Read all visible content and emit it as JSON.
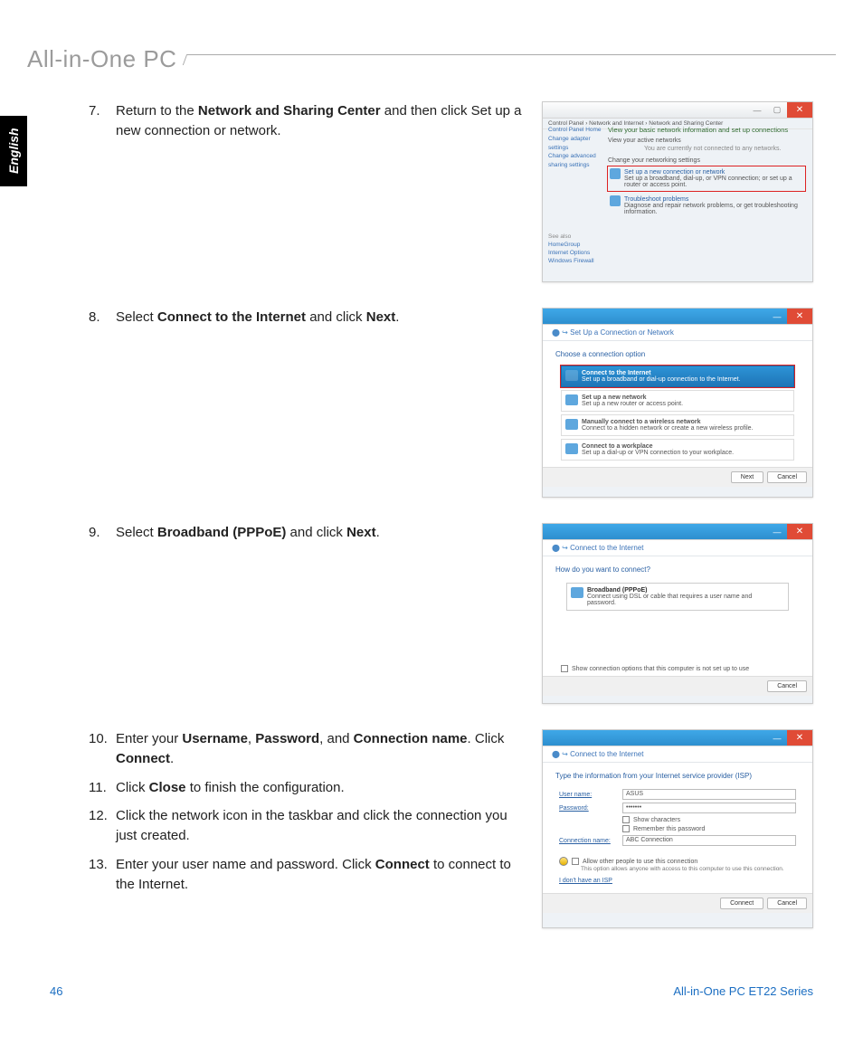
{
  "header": {
    "title": "All-in-One PC"
  },
  "lang_tab": "English",
  "footer": {
    "page": "46",
    "series": "All-in-One PC ET22 Series"
  },
  "sections": [
    {
      "steps": [
        {
          "num": "7.",
          "html": "Return to the <b>Network and Sharing Center</b> and then click Set up a new connection or network."
        }
      ],
      "shot": "nsc"
    },
    {
      "steps": [
        {
          "num": "8.",
          "html": "Select <b>Connect to the Internet</b> and click <b>Next</b>."
        }
      ],
      "shot": "options"
    },
    {
      "steps": [
        {
          "num": "9.",
          "html": "Select <b>Broadband (PPPoE)</b> and click <b>Next</b>."
        }
      ],
      "shot": "pppoe"
    },
    {
      "steps": [
        {
          "num": "10.",
          "html": "Enter your <b>Username</b>, <b>Password</b>, and <b>Connection name</b>. Click <b>Connect</b>."
        },
        {
          "num": "11.",
          "html": "Click <b>Close</b> to finish the configuration."
        },
        {
          "num": "12.",
          "html": "Click the network icon in the taskbar and click the connection you just created."
        },
        {
          "num": "13.",
          "html": "Enter your user name and password. Click <b>Connect</b> to connect to the Internet."
        }
      ],
      "shot": "creds"
    }
  ],
  "shots": {
    "nsc": {
      "breadcrumb": "Control Panel › Network and Internet › Network and Sharing Center",
      "sidebar": [
        "Control Panel Home",
        "Change adapter settings",
        "Change advanced sharing settings"
      ],
      "seealso": [
        "HomeGroup",
        "Internet Options",
        "Windows Firewall"
      ],
      "heading": "View your basic network information and set up connections",
      "sub1": "View your active networks",
      "sub1_note": "You are currently not connected to any networks.",
      "chg": "Change your networking settings",
      "opt1_head": "Set up a new connection or network",
      "opt1_sub": "Set up a broadband, dial-up, or VPN connection; or set up a router or access point.",
      "opt2_head": "Troubleshoot problems",
      "opt2_sub": "Diagnose and repair network problems, or get troubleshooting information."
    },
    "options": {
      "title": "Set Up a Connection or Network",
      "prompt": "Choose a connection option",
      "items": [
        {
          "head": "Connect to the Internet",
          "sub": "Set up a broadband or dial-up connection to the Internet.",
          "selected": true,
          "red": true
        },
        {
          "head": "Set up a new network",
          "sub": "Set up a new router or access point."
        },
        {
          "head": "Manually connect to a wireless network",
          "sub": "Connect to a hidden network or create a new wireless profile."
        },
        {
          "head": "Connect to a workplace",
          "sub": "Set up a dial-up or VPN connection to your workplace."
        }
      ],
      "buttons": [
        "Next",
        "Cancel"
      ]
    },
    "pppoe": {
      "title": "Connect to the Internet",
      "prompt": "How do you want to connect?",
      "item_head": "Broadband (PPPoE)",
      "item_sub": "Connect using DSL or cable that requires a user name and password.",
      "checkbox": "Show connection options that this computer is not set up to use",
      "buttons": [
        "Cancel"
      ]
    },
    "creds": {
      "title": "Connect to the Internet",
      "prompt": "Type the information from your Internet service provider (ISP)",
      "fields": {
        "user_label": "User name:",
        "user_val": "ASUS",
        "pass_label": "Password:",
        "pass_val": "•••••••",
        "showchars": "Show characters",
        "remember": "Remember this password",
        "conn_label": "Connection name:",
        "conn_val": "ABC Connection"
      },
      "allow": "Allow other people to use this connection",
      "allow_sub": "This option allows anyone with access to this computer to use this connection.",
      "link": "I don't have an ISP",
      "buttons": [
        "Connect",
        "Cancel"
      ]
    }
  }
}
